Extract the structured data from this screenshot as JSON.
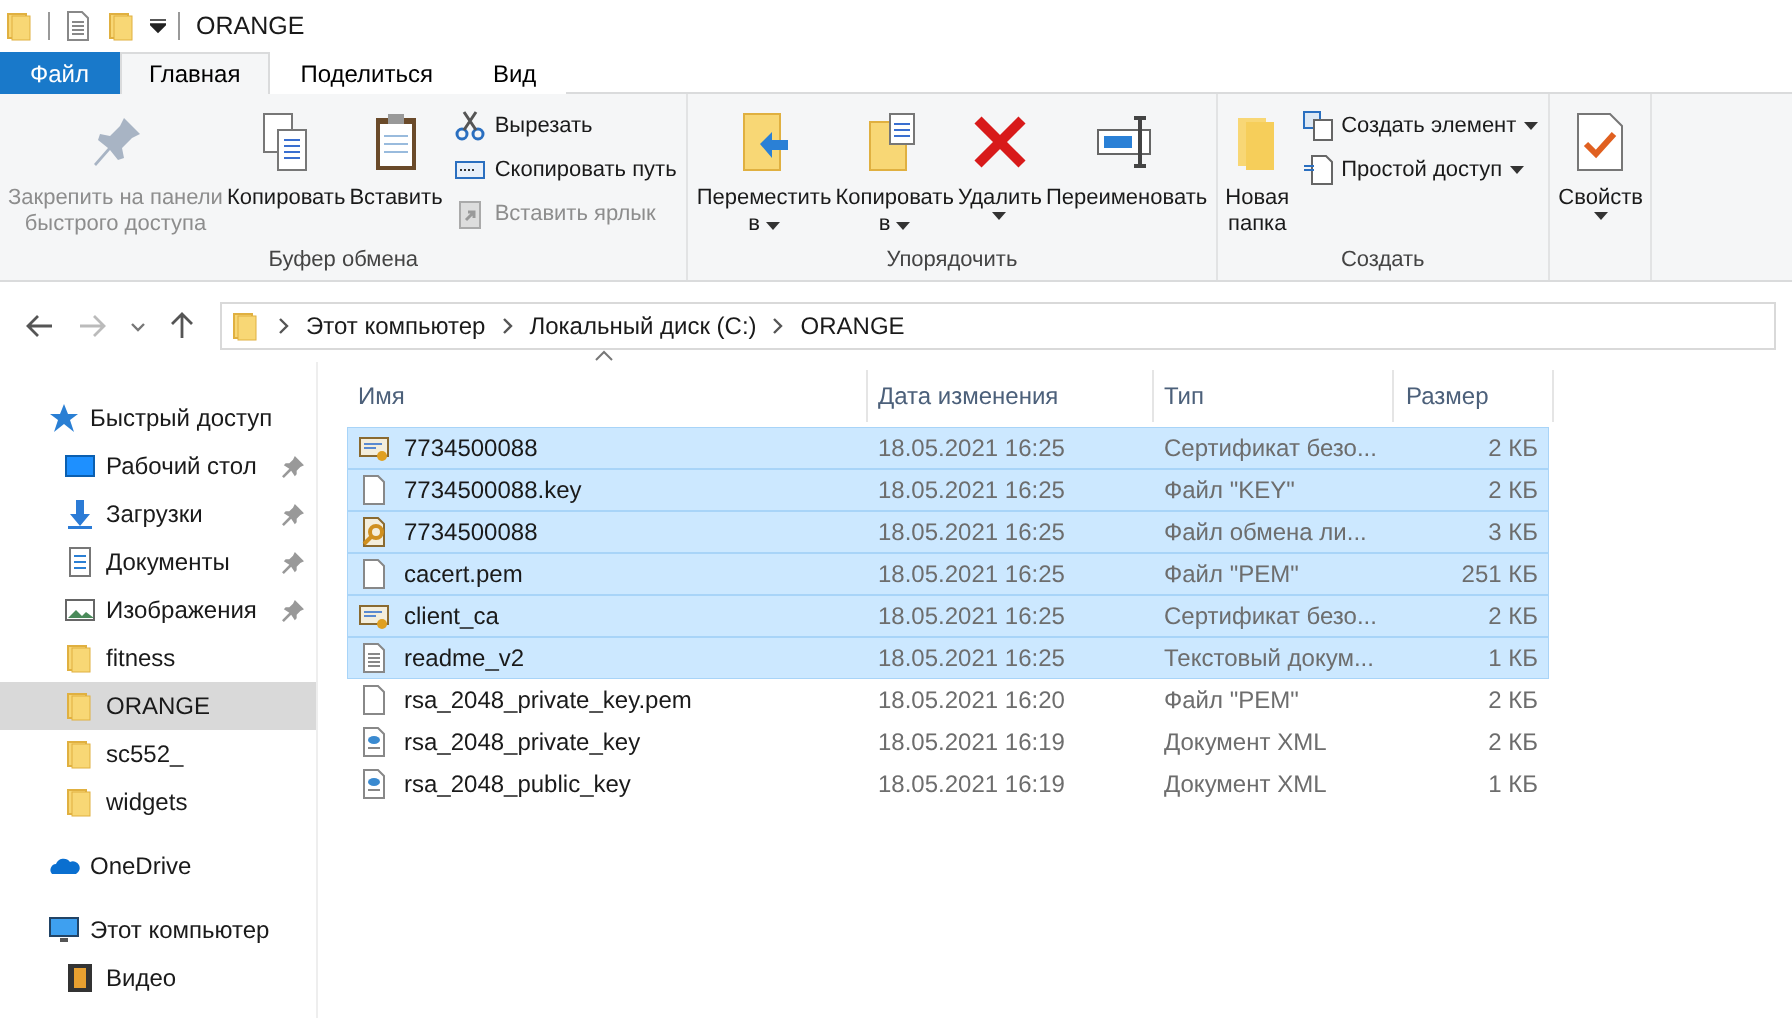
{
  "window": {
    "title": "ORANGE"
  },
  "tabs": [
    {
      "label": "Файл",
      "kind": "file",
      "selected": false
    },
    {
      "label": "Главная",
      "kind": "tab",
      "selected": true
    },
    {
      "label": "Поделиться",
      "kind": "tab",
      "selected": false
    },
    {
      "label": "Вид",
      "kind": "tab",
      "selected": false
    }
  ],
  "ribbon": {
    "groups": [
      {
        "label": "Буфер обмена",
        "items": [
          {
            "kind": "pin",
            "lines": [
              "Закрепить на панели",
              "быстрого доступа"
            ],
            "dropdown": false,
            "disabled": true
          },
          {
            "kind": "copy",
            "lines": [
              "Копировать"
            ],
            "dropdown": false,
            "disabled": false
          },
          {
            "kind": "paste",
            "lines": [
              "Вставить"
            ],
            "dropdown": false,
            "disabled": false
          },
          {
            "kind": "stack",
            "items": [
              {
                "kind": "scissors",
                "label": "Вырезать",
                "dropdown": false,
                "disabled": false
              },
              {
                "kind": "path",
                "label": "Скопировать путь",
                "dropdown": false,
                "disabled": false
              },
              {
                "kind": "shortcut",
                "label": "Вставить ярлык",
                "dropdown": false,
                "disabled": true
              }
            ]
          }
        ]
      },
      {
        "label": "Упорядочить",
        "items": [
          {
            "kind": "move",
            "lines": [
              "Переместить",
              "в"
            ],
            "dropdown": true,
            "disabled": false
          },
          {
            "kind": "copyto",
            "lines": [
              "Копировать",
              "в"
            ],
            "dropdown": true,
            "disabled": false
          },
          {
            "kind": "delete",
            "lines": [
              "Удалить"
            ],
            "dropdown": true,
            "disabled": false
          },
          {
            "kind": "rename",
            "lines": [
              "Переименовать"
            ],
            "dropdown": false,
            "disabled": false
          }
        ]
      },
      {
        "label": "Создать",
        "items": [
          {
            "kind": "newfolder",
            "lines": [
              "Новая",
              "папка"
            ],
            "dropdown": false,
            "disabled": false
          },
          {
            "kind": "stack",
            "items": [
              {
                "kind": "newitem",
                "label": "Создать элемент",
                "dropdown": true,
                "disabled": false
              },
              {
                "kind": "easyaccess",
                "label": "Простой доступ",
                "dropdown": true,
                "disabled": false
              }
            ]
          }
        ]
      },
      {
        "items": [
          {
            "kind": "properties",
            "lines": [
              "Свойств"
            ],
            "dropdown": true,
            "disabled": false
          }
        ]
      }
    ]
  },
  "address": {
    "crumbs": [
      "Этот компьютер",
      "Локальный диск (C:)",
      "ORANGE"
    ]
  },
  "nav": [
    {
      "label": "Быстрый доступ",
      "kind": "star",
      "pinned": false,
      "selected": false
    },
    {
      "label": "Рабочий стол",
      "kind": "desktop",
      "pinned": true,
      "selected": false
    },
    {
      "label": "Загрузки",
      "kind": "download",
      "pinned": true,
      "selected": false
    },
    {
      "label": "Документы",
      "kind": "documents",
      "pinned": true,
      "selected": false
    },
    {
      "label": "Изображения",
      "kind": "pictures",
      "pinned": true,
      "selected": false
    },
    {
      "label": "fitness",
      "kind": "folder",
      "pinned": false,
      "selected": false
    },
    {
      "label": "ORANGE",
      "kind": "folder",
      "pinned": false,
      "selected": true
    },
    {
      "label": "sc552_",
      "kind": "folder",
      "pinned": false,
      "selected": false
    },
    {
      "label": "widgets",
      "kind": "folder",
      "pinned": false,
      "selected": false
    },
    {
      "label": "OneDrive",
      "kind": "cloud",
      "pinned": false,
      "selected": false
    },
    {
      "label": "Этот компьютер",
      "kind": "pc",
      "pinned": false,
      "selected": false
    },
    {
      "label": "Видео",
      "kind": "video",
      "pinned": false,
      "selected": false
    }
  ],
  "table": {
    "columns": [
      "Имя",
      "Дата изменения",
      "Тип",
      "Размер"
    ],
    "rows": [
      {
        "kind": "cert",
        "name": "7734500088",
        "date": "18.05.2021 16:25",
        "type": "Сертификат безо...",
        "size": "2 КБ",
        "selected": true
      },
      {
        "kind": "file",
        "name": "7734500088.key",
        "date": "18.05.2021 16:25",
        "type": "Файл \"KEY\"",
        "size": "2 КБ",
        "selected": true
      },
      {
        "kind": "pfx",
        "name": "7734500088",
        "date": "18.05.2021 16:25",
        "type": "Файл обмена ли...",
        "size": "3 КБ",
        "selected": true
      },
      {
        "kind": "file",
        "name": "cacert.pem",
        "date": "18.05.2021 16:25",
        "type": "Файл \"PEM\"",
        "size": "251 КБ",
        "selected": true
      },
      {
        "kind": "cert",
        "name": "client_ca",
        "date": "18.05.2021 16:25",
        "type": "Сертификат безо...",
        "size": "2 КБ",
        "selected": true
      },
      {
        "kind": "text",
        "name": "readme_v2",
        "date": "18.05.2021 16:25",
        "type": "Текстовый докум...",
        "size": "1 КБ",
        "selected": true
      },
      {
        "kind": "file",
        "name": "rsa_2048_private_key.pem",
        "date": "18.05.2021 16:20",
        "type": "Файл \"PEM\"",
        "size": "2 КБ",
        "selected": false
      },
      {
        "kind": "xml",
        "name": "rsa_2048_private_key",
        "date": "18.05.2021 16:19",
        "type": "Документ XML",
        "size": "2 КБ",
        "selected": false
      },
      {
        "kind": "xml",
        "name": "rsa_2048_public_key",
        "date": "18.05.2021 16:19",
        "type": "Документ XML",
        "size": "1 КБ",
        "selected": false
      }
    ]
  }
}
